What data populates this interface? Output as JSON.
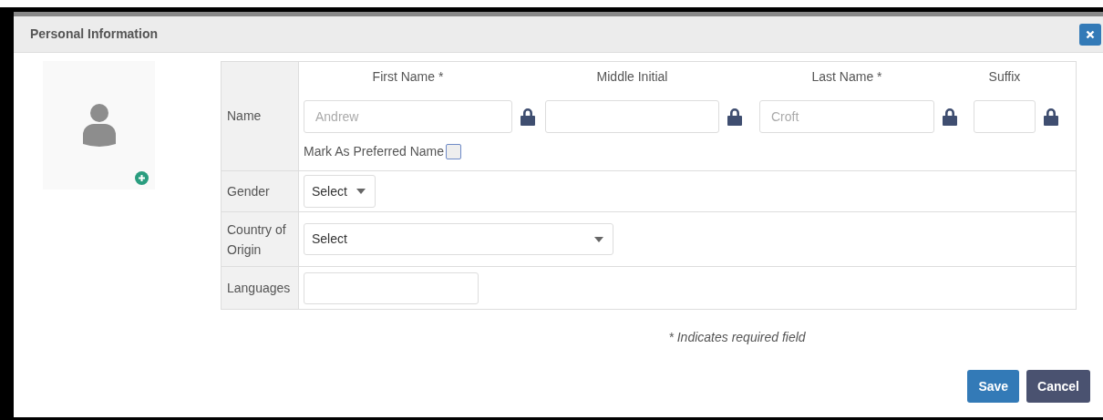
{
  "dialog": {
    "title": "Personal Information"
  },
  "name_row": {
    "label": "Name",
    "fields": [
      {
        "heading": "First Name *",
        "placeholder": "Andrew"
      },
      {
        "heading": "Middle Initial"
      },
      {
        "heading": "Last Name *",
        "placeholder": "Croft"
      },
      {
        "heading": "Suffix"
      }
    ],
    "preferred": {
      "label": "Mark As Preferred Name",
      "checked": false
    }
  },
  "gender": {
    "label": "Gender",
    "value": "Select"
  },
  "country": {
    "label": "Country of Origin",
    "value": "Select"
  },
  "languages": {
    "label": "Languages"
  },
  "note": "* Indicates required field",
  "buttons": [
    {
      "label": "Save",
      "kind": "primary"
    },
    {
      "label": "Cancel",
      "kind": "secondary"
    }
  ]
}
